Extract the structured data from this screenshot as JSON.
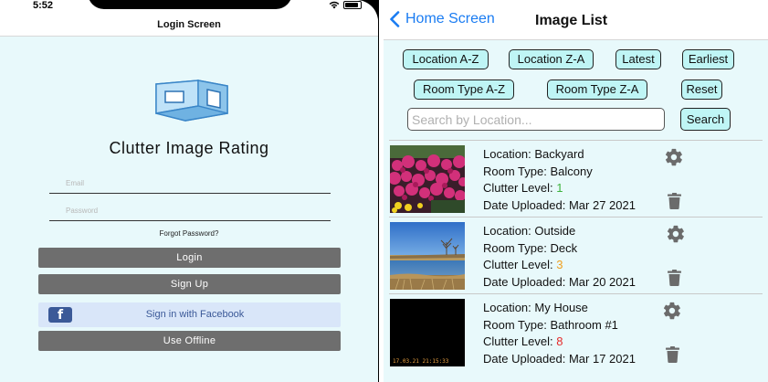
{
  "left_screen": {
    "status_time": "5:52",
    "nav_title": "Login Screen",
    "app_title": "Clutter Image Rating",
    "email_placeholder": "Email",
    "password_placeholder": "Password",
    "forgot_password": "Forgot Password?",
    "login_label": "Login",
    "signup_label": "Sign Up",
    "facebook_label": "Sign in with Facebook",
    "facebook_icon_glyph": "f",
    "offline_label": "Use Offline",
    "colors": {
      "background": "#e8f9fb",
      "button_grey": "#6e6e6e",
      "facebook_blue": "#3b5998",
      "facebook_button_bg": "#d9e6f9"
    }
  },
  "right_screen": {
    "back_label": "Home Screen",
    "nav_title": "Image List",
    "sort_buttons": [
      {
        "label": "Location A-Z"
      },
      {
        "label": "Location Z-A"
      },
      {
        "label": "Latest"
      },
      {
        "label": "Earliest"
      },
      {
        "label": "Room Type A-Z"
      },
      {
        "label": "Room Type Z-A"
      },
      {
        "label": "Reset"
      }
    ],
    "search_placeholder": "Search by Location...",
    "search_button": "Search",
    "items": [
      {
        "location_label": "Location:",
        "location": "Backyard",
        "room_label": "Room Type:",
        "room": "Balcony",
        "clutter_label": "Clutter Level:",
        "clutter": "1",
        "clutter_color": "#3bb33b",
        "date_label": "Date Uploaded:",
        "date": "Mar 27 2021",
        "thumb": "pink-flowers"
      },
      {
        "location_label": "Location:",
        "location": "Outside",
        "room_label": "Room Type:",
        "room": "Deck",
        "clutter_label": "Clutter Level:",
        "clutter": "3",
        "clutter_color": "#f0a020",
        "date_label": "Date Uploaded:",
        "date": "Mar 20 2021",
        "thumb": "lake-landscape"
      },
      {
        "location_label": "Location:",
        "location": "My House",
        "room_label": "Room Type:",
        "room": "Bathroom #1",
        "clutter_label": "Clutter Level:",
        "clutter": "8",
        "clutter_color": "#e52b2b",
        "date_label": "Date Uploaded:",
        "date": "Mar 17 2021",
        "thumb": "black-photo",
        "thumb_stamp": "17.03.21 21:15:33"
      }
    ],
    "colors": {
      "background": "#e8f9fb",
      "pill_bg": "#bff5f5",
      "link_blue": "#1a7cf2"
    }
  }
}
